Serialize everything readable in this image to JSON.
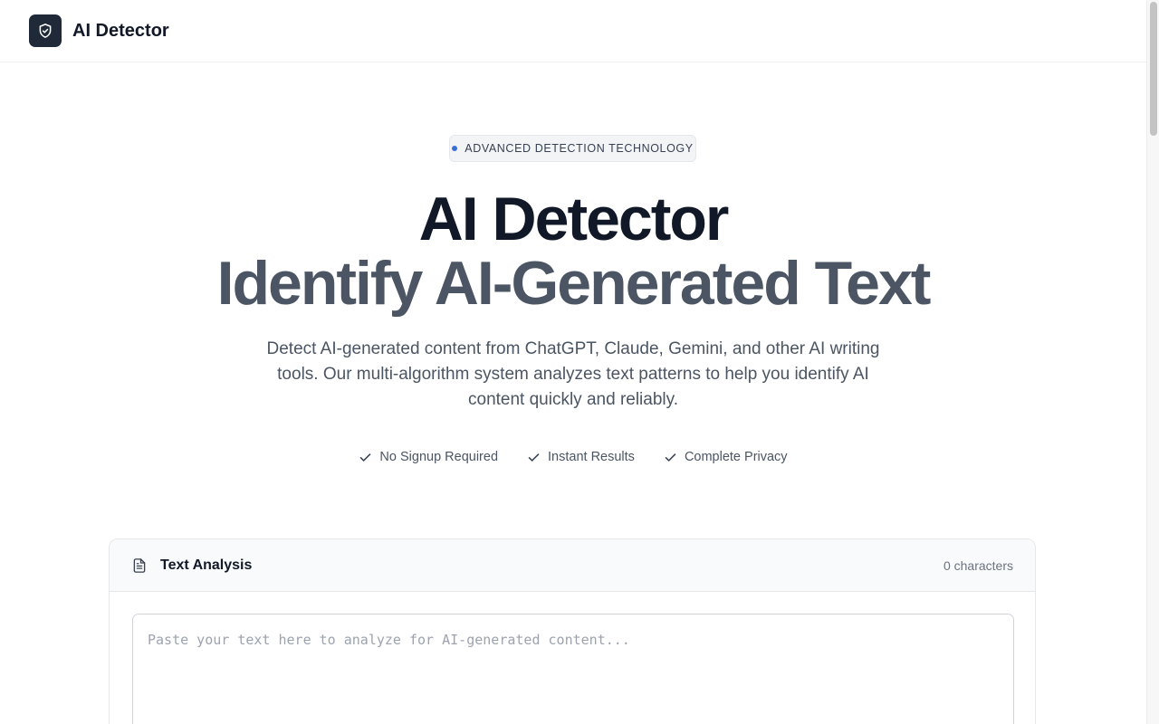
{
  "header": {
    "brand": "AI Detector",
    "logo_icon": "shield-check-icon"
  },
  "hero": {
    "badge": "ADVANCED DETECTION TECHNOLOGY",
    "title_line1": "AI Detector",
    "title_line2": "Identify AI-Generated Text",
    "subtitle": "Detect AI-generated content from ChatGPT, Claude, Gemini, and other AI writing tools. Our multi-algorithm system analyzes text patterns to help you identify AI content quickly and reliably.",
    "features": [
      {
        "label": "No Signup Required",
        "icon": "check-icon"
      },
      {
        "label": "Instant Results",
        "icon": "check-icon"
      },
      {
        "label": "Complete Privacy",
        "icon": "check-icon"
      }
    ]
  },
  "analysis": {
    "title": "Text Analysis",
    "char_count": "0 characters",
    "placeholder": "Paste your text here to analyze for AI-generated content...",
    "icon": "document-icon"
  },
  "colors": {
    "accent_dot": "#3b6fd8",
    "logo_bg": "#1f2937",
    "title_primary": "#111827",
    "title_secondary": "#4b5563"
  }
}
